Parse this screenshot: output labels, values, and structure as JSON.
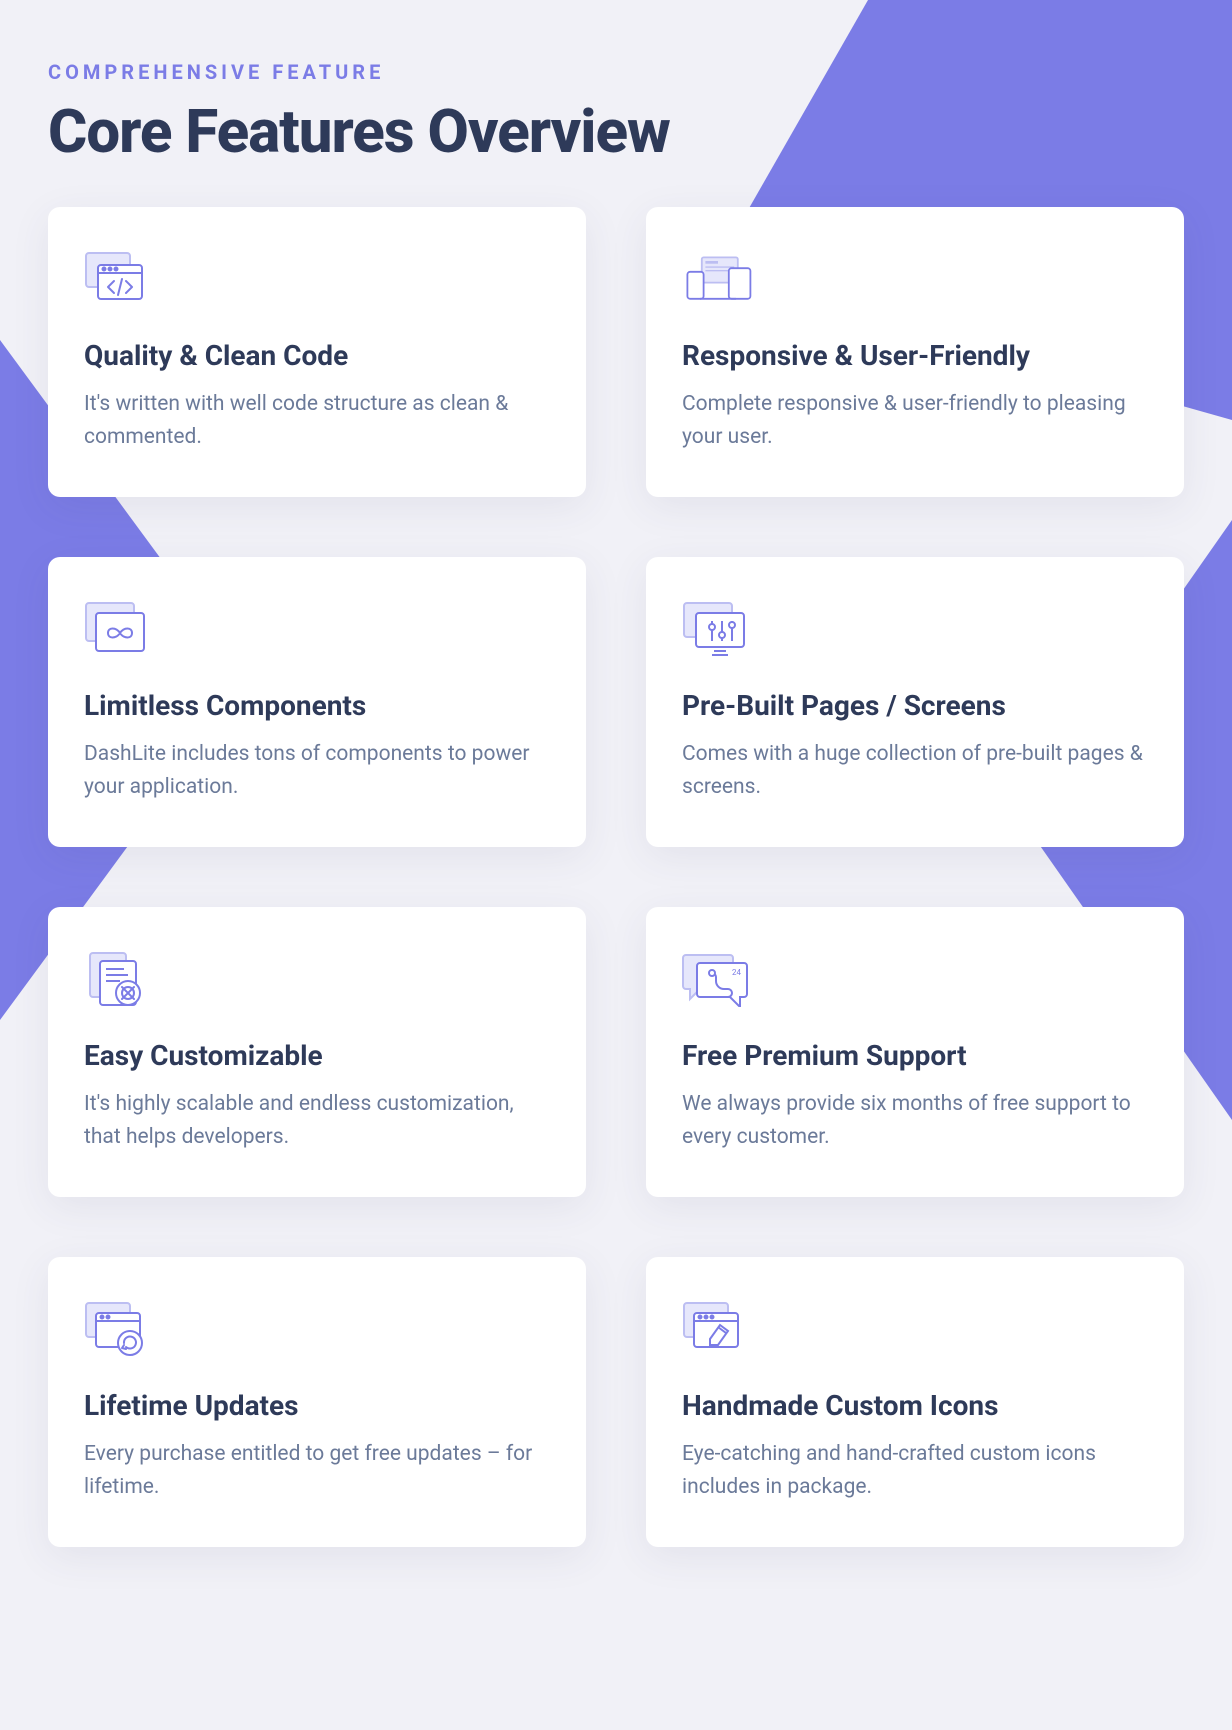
{
  "eyebrow": "COMPREHENSIVE FEATURE",
  "title": "Core Features Overview",
  "features": [
    {
      "icon": "code-window",
      "title": "Quality & Clean Code",
      "desc": "It's written with well code structure as clean & commented."
    },
    {
      "icon": "responsive",
      "title": "Responsive & User-Friendly",
      "desc": "Complete responsive & user-friendly to pleasing your user."
    },
    {
      "icon": "infinity",
      "title": "Limitless Components",
      "desc": "DashLite includes tons of components to power your application."
    },
    {
      "icon": "sliders",
      "title": "Pre-Built Pages / Screens",
      "desc": "Comes with a huge collection of pre-built pages & screens."
    },
    {
      "icon": "customize",
      "title": "Easy Customizable",
      "desc": "It's highly scalable and endless customization, that helps developers."
    },
    {
      "icon": "support",
      "title": "Free Premium Support",
      "desc": "We always provide six months of free support to every customer."
    },
    {
      "icon": "refresh",
      "title": "Lifetime Updates",
      "desc": "Every purchase entitled to get free updates – for lifetime."
    },
    {
      "icon": "pen",
      "title": "Handmade Custom Icons",
      "desc": "Eye-catching and hand-crafted custom icons includes in package."
    }
  ],
  "colors": {
    "accent": "#7b7ce6",
    "heading": "#2e3a59",
    "body": "#6b7a99"
  }
}
